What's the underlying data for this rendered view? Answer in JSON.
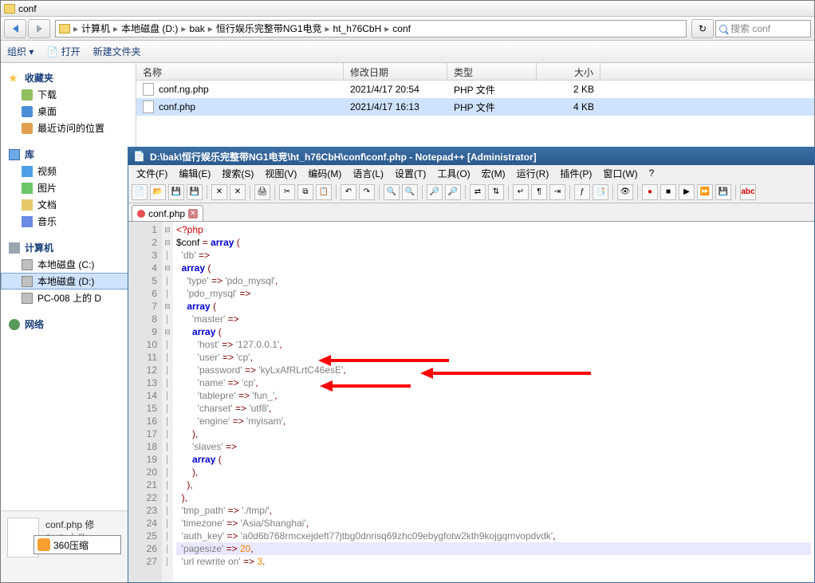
{
  "explorer": {
    "title": "conf",
    "breadcrumb": [
      "计算机",
      "本地磁盘 (D:)",
      "bak",
      "恒行娱乐完整带NG1电竞",
      "ht_h76CbH",
      "conf"
    ],
    "search_placeholder": "搜索 conf",
    "toolbar": {
      "organize": "组织 ▾",
      "open": "打开",
      "new_folder": "新建文件夹"
    },
    "columns": {
      "name": "名称",
      "date": "修改日期",
      "type": "类型",
      "size": "大小"
    },
    "files": [
      {
        "name": "conf.ng.php",
        "date": "2021/4/17 20:54",
        "type": "PHP 文件",
        "size": "2 KB",
        "selected": false
      },
      {
        "name": "conf.php",
        "date": "2021/4/17 16:13",
        "type": "PHP 文件",
        "size": "4 KB",
        "selected": true
      }
    ],
    "sidebar": {
      "favorites": {
        "title": "收藏夹",
        "items": [
          "下载",
          "桌面",
          "最近访问的位置"
        ]
      },
      "libraries": {
        "title": "库",
        "items": [
          "视频",
          "图片",
          "文档",
          "音乐"
        ]
      },
      "computer": {
        "title": "计算机",
        "items": [
          "本地磁盘 (C:)",
          "本地磁盘 (D:)",
          "PC-008 上的 D"
        ]
      },
      "network": {
        "title": "网络"
      }
    },
    "status": {
      "name": "conf.php 修",
      "type": "PHP 文件"
    },
    "taskbar_item": "360压缩"
  },
  "npp": {
    "title": "D:\\bak\\恒行娱乐完整带NG1电竞\\ht_h76CbH\\conf\\conf.php - Notepad++ [Administrator]",
    "menu": [
      "文件(F)",
      "编辑(E)",
      "搜索(S)",
      "视图(V)",
      "编码(M)",
      "语言(L)",
      "设置(T)",
      "工具(O)",
      "宏(M)",
      "运行(R)",
      "插件(P)",
      "窗口(W)",
      "?"
    ],
    "tab": "conf.php",
    "lines": 27,
    "code_values": {
      "host": "127.0.0.1",
      "user": "cp",
      "password": "kyLxAfRLrtC46esE",
      "name": "cp",
      "tablepre": "fun_",
      "charset": "utf8",
      "engine": "myisam",
      "tmp_path": "./tmp/",
      "timezone": "Asia/Shanghai",
      "auth_key": "a0d6b768rmcxejdeft77jtbg0dnrisq69zhc09ebygfotw2kth9kojgqmvopdvdk",
      "pagesize": "20",
      "url_rewrite_on": "3"
    }
  }
}
